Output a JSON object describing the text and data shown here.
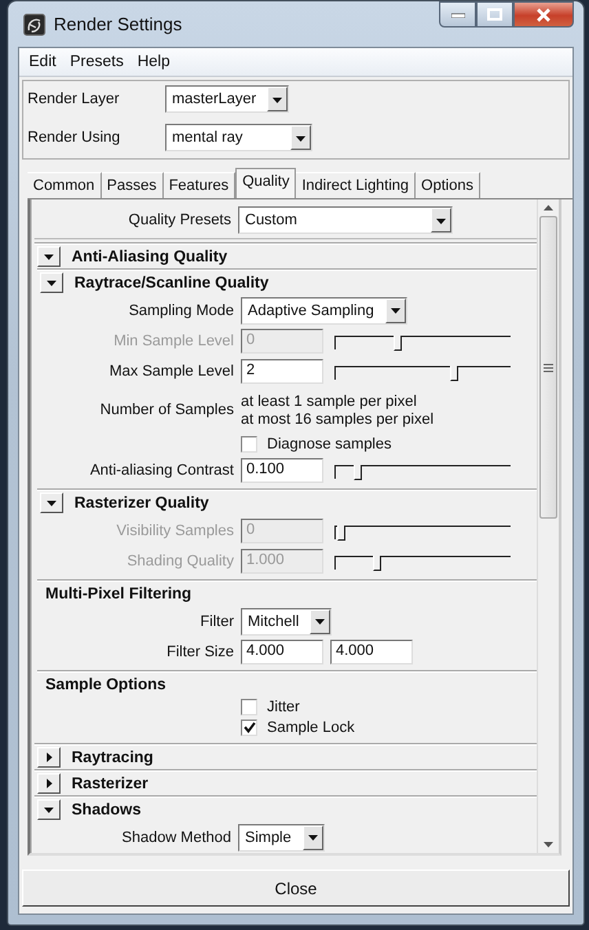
{
  "window": {
    "title": "Render Settings"
  },
  "menu": [
    "Edit",
    "Presets",
    "Help"
  ],
  "header_rows": [
    {
      "label": "Render Layer",
      "value": "masterLayer"
    },
    {
      "label": "Render Using",
      "value": "mental ray"
    }
  ],
  "tabs": [
    {
      "label": "Common",
      "selected": false
    },
    {
      "label": "Passes",
      "selected": false
    },
    {
      "label": "Features",
      "selected": false
    },
    {
      "label": "Quality",
      "selected": true
    },
    {
      "label": "Indirect Lighting",
      "selected": false
    },
    {
      "label": "Options",
      "selected": false
    }
  ],
  "quality_presets": {
    "label": "Quality Presets",
    "value": "Custom"
  },
  "sections": [
    {
      "kind": "collapsible",
      "title": "Anti-Aliasing Quality",
      "expanded": true,
      "children": [
        {
          "kind": "collapsible",
          "title": "Raytrace/Scanline Quality",
          "expanded": true,
          "rows": [
            {
              "kind": "dropdown",
              "label": "Sampling Mode",
              "value": "Adaptive Sampling"
            },
            {
              "kind": "slider",
              "label": "Min Sample Level",
              "value": "0",
              "disabled": true,
              "level": 0.35
            },
            {
              "kind": "slider",
              "label": "Max Sample Level",
              "value": "2",
              "disabled": false,
              "level": 0.67
            },
            {
              "kind": "info",
              "label": "Number of Samples",
              "lines": [
                "at least 1 sample per pixel",
                "at most 16 samples per pixel"
              ]
            },
            {
              "kind": "checkbox",
              "label": "Diagnose samples",
              "checked": false
            },
            {
              "kind": "slider",
              "label": "Anti-aliasing Contrast",
              "value": "0.100",
              "disabled": false,
              "level": 0.12
            }
          ]
        },
        {
          "kind": "collapsible",
          "title": "Rasterizer Quality",
          "expanded": true,
          "rows": [
            {
              "kind": "slider",
              "label": "Visibility Samples",
              "value": "0",
              "disabled": true,
              "level": 0.02
            },
            {
              "kind": "slider",
              "label": "Shading Quality",
              "value": "1.000",
              "disabled": true,
              "level": 0.23
            }
          ]
        },
        {
          "kind": "group",
          "title": "Multi-Pixel Filtering",
          "rows": [
            {
              "kind": "dropdown",
              "label": "Filter",
              "value": "Mitchell"
            },
            {
              "kind": "fields",
              "label": "Filter Size",
              "values": [
                "4.000",
                "4.000"
              ]
            }
          ]
        },
        {
          "kind": "group",
          "title": "Sample Options",
          "rows": [
            {
              "kind": "checkbox",
              "label": "Jitter",
              "checked": false
            },
            {
              "kind": "checkbox",
              "label": "Sample Lock",
              "checked": true
            }
          ]
        }
      ]
    },
    {
      "kind": "collapsible",
      "title": "Raytracing",
      "expanded": false
    },
    {
      "kind": "collapsible",
      "title": "Rasterizer",
      "expanded": false
    },
    {
      "kind": "collapsible",
      "title": "Shadows",
      "expanded": true,
      "rows": [
        {
          "kind": "dropdown",
          "label": "Shadow Method",
          "value": "Simple"
        }
      ]
    }
  ],
  "close_button": "Close"
}
